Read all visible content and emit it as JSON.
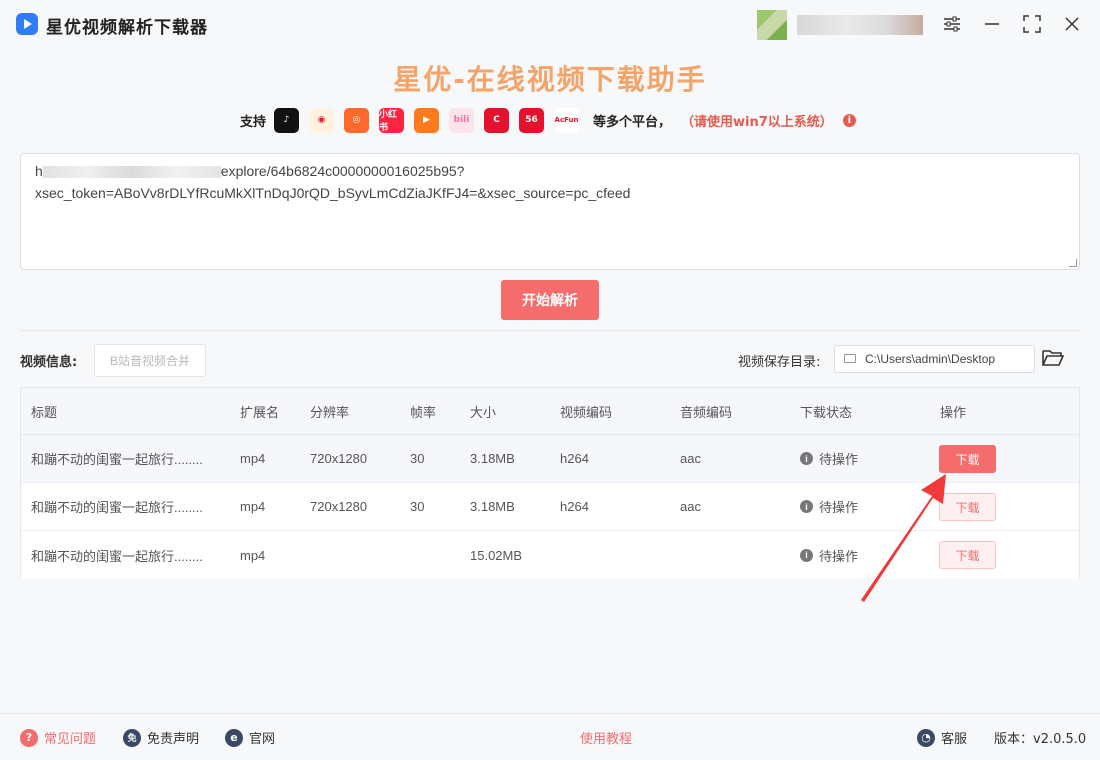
{
  "app": {
    "title": "星优视频解析下载器"
  },
  "window": {
    "settings": "⚙",
    "minimize": "—",
    "maximize": "⛶",
    "close": "✕"
  },
  "heading": "星优-在线视频下载助手",
  "support": {
    "label": "支持",
    "platforms": [
      {
        "name": "tiktok-icon",
        "glyph": "♪",
        "color": "#111111"
      },
      {
        "name": "weibo-icon",
        "glyph": "◉",
        "color": "#f5a623"
      },
      {
        "name": "kuaishou-icon",
        "glyph": "◎",
        "color": "#ff6a2c"
      },
      {
        "name": "xiaohongshu-icon",
        "glyph": "小红书",
        "color": "#ff2442"
      },
      {
        "name": "tencent-video-icon",
        "glyph": "▶",
        "color": "#ffffff"
      },
      {
        "name": "bilibili-icon",
        "glyph": "bili",
        "color": "#fb7299"
      },
      {
        "name": "cctv-icon",
        "glyph": "C",
        "color": "#ffffff"
      },
      {
        "name": "56-icon",
        "glyph": "56",
        "color": "#ffffff"
      },
      {
        "name": "acfun-icon",
        "glyph": "AcFun",
        "color": "#ffffff"
      }
    ],
    "tail": "等多个平台，",
    "note": "（请使用win7以上系统）",
    "info": "i"
  },
  "url_input": {
    "line1_prefix": "h",
    "line1_suffix": "explore/64b6824c0000000016025b95?",
    "line2": "xsec_token=ABoVv8rDLYfRcuMkXlTnDqJ0rQD_bSyvLmCdZiaJKfFJ4=&xsec_source=pc_cfeed"
  },
  "parse_button": "开始解析",
  "video_info_label": "视频信息:",
  "merge_button": "B站音视频合并",
  "save_dir": {
    "label": "视频保存目录:",
    "value": "C:\\Users\\admin\\Desktop"
  },
  "table": {
    "headers": [
      "标题",
      "扩展名",
      "分辨率",
      "帧率",
      "大小",
      "视频编码",
      "音频编码",
      "下载状态",
      "操作"
    ],
    "rows": [
      {
        "title": "和蹦不动的闺蜜一起旅行........",
        "ext": "mp4",
        "res": "720x1280",
        "fps": "30",
        "size": "3.18MB",
        "vcodec": "h264",
        "acodec": "aac",
        "status": "待操作",
        "action": "下载"
      },
      {
        "title": "和蹦不动的闺蜜一起旅行........",
        "ext": "mp4",
        "res": "720x1280",
        "fps": "30",
        "size": "3.18MB",
        "vcodec": "h264",
        "acodec": "aac",
        "status": "待操作",
        "action": "下载"
      },
      {
        "title": "和蹦不动的闺蜜一起旅行........",
        "ext": "mp4",
        "res": "",
        "fps": "",
        "size": "15.02MB",
        "vcodec": "",
        "acodec": "",
        "status": "待操作",
        "action": "下载"
      }
    ]
  },
  "footer": {
    "faq": "常见问题",
    "disclaimer": "免责声明",
    "website": "官网",
    "tutorial": "使用教程",
    "service": "客服",
    "version": "版本：v2.0.5.0"
  },
  "colors": {
    "accent": "#f46c6c",
    "heading": "#f4a46a",
    "note": "#e45b4f"
  }
}
